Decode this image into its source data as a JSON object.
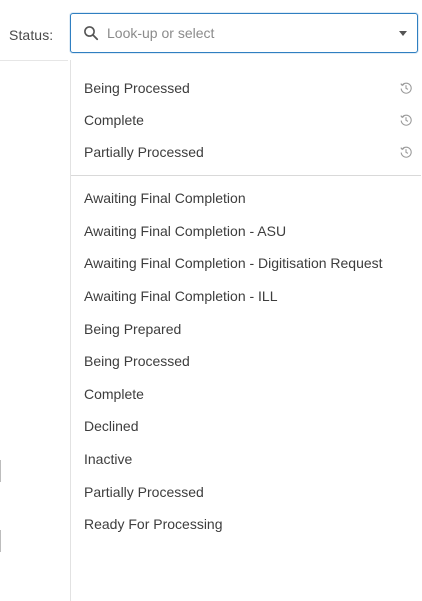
{
  "field": {
    "label": "Status:",
    "placeholder": "Look-up or select",
    "value": ""
  },
  "icons": {
    "search": "search-icon",
    "dropdown": "chevron-down-icon",
    "recent": "history-icon"
  },
  "colors": {
    "focus_border": "#2f7fc1",
    "text": "#3d3d3d",
    "placeholder": "#8b8b8b",
    "divider": "#d9d9d9"
  },
  "recent_options": [
    {
      "label": "Being Processed"
    },
    {
      "label": "Complete"
    },
    {
      "label": "Partially Processed"
    }
  ],
  "all_options": [
    {
      "label": "Awaiting Final Completion"
    },
    {
      "label": "Awaiting Final Completion - ASU"
    },
    {
      "label": "Awaiting Final Completion - Digitisation Request"
    },
    {
      "label": "Awaiting Final Completion - ILL"
    },
    {
      "label": "Being Prepared"
    },
    {
      "label": "Being Processed"
    },
    {
      "label": "Complete"
    },
    {
      "label": "Declined"
    },
    {
      "label": "Inactive"
    },
    {
      "label": "Partially Processed"
    },
    {
      "label": "Ready For Processing"
    }
  ]
}
